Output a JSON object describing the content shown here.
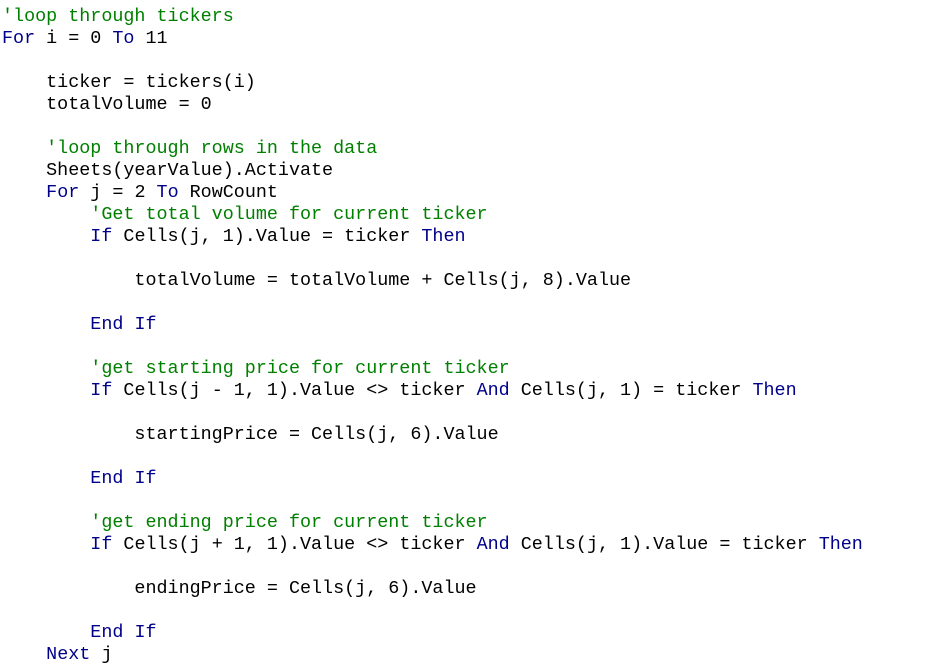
{
  "colors": {
    "background": "#ffffff",
    "plain_text": "#000000",
    "comment": "#008000",
    "keyword": "#00008b"
  },
  "code": {
    "lines": [
      [
        {
          "t": "'loop through tickers",
          "k": "comment"
        }
      ],
      [
        {
          "t": "For",
          "k": "keyword"
        },
        {
          "t": " i = 0 ",
          "k": "plain"
        },
        {
          "t": "To",
          "k": "keyword"
        },
        {
          "t": " 11",
          "k": "plain"
        }
      ],
      [],
      [
        {
          "t": "    ticker = tickers(i)",
          "k": "plain"
        }
      ],
      [
        {
          "t": "    totalVolume = 0",
          "k": "plain"
        }
      ],
      [],
      [
        {
          "t": "    'loop through rows in the data",
          "k": "comment"
        }
      ],
      [
        {
          "t": "    Sheets(yearValue).Activate",
          "k": "plain"
        }
      ],
      [
        {
          "t": "    ",
          "k": "plain"
        },
        {
          "t": "For",
          "k": "keyword"
        },
        {
          "t": " j = 2 ",
          "k": "plain"
        },
        {
          "t": "To",
          "k": "keyword"
        },
        {
          "t": " RowCount",
          "k": "plain"
        }
      ],
      [
        {
          "t": "        'Get total volume for current ticker",
          "k": "comment"
        }
      ],
      [
        {
          "t": "        ",
          "k": "plain"
        },
        {
          "t": "If",
          "k": "keyword"
        },
        {
          "t": " Cells(j, 1).Value = ticker ",
          "k": "plain"
        },
        {
          "t": "Then",
          "k": "keyword"
        }
      ],
      [],
      [
        {
          "t": "            totalVolume = totalVolume + Cells(j, 8).Value",
          "k": "plain"
        }
      ],
      [],
      [
        {
          "t": "        ",
          "k": "plain"
        },
        {
          "t": "End If",
          "k": "keyword"
        }
      ],
      [],
      [
        {
          "t": "        'get starting price for current ticker",
          "k": "comment"
        }
      ],
      [
        {
          "t": "        ",
          "k": "plain"
        },
        {
          "t": "If",
          "k": "keyword"
        },
        {
          "t": " Cells(j - 1, 1).Value <> ticker ",
          "k": "plain"
        },
        {
          "t": "And",
          "k": "keyword"
        },
        {
          "t": " Cells(j, 1) = ticker ",
          "k": "plain"
        },
        {
          "t": "Then",
          "k": "keyword"
        }
      ],
      [],
      [
        {
          "t": "            startingPrice = Cells(j, 6).Value",
          "k": "plain"
        }
      ],
      [],
      [
        {
          "t": "        ",
          "k": "plain"
        },
        {
          "t": "End If",
          "k": "keyword"
        }
      ],
      [],
      [
        {
          "t": "        'get ending price for current ticker",
          "k": "comment"
        }
      ],
      [
        {
          "t": "        ",
          "k": "plain"
        },
        {
          "t": "If",
          "k": "keyword"
        },
        {
          "t": " Cells(j + 1, 1).Value <> ticker ",
          "k": "plain"
        },
        {
          "t": "And",
          "k": "keyword"
        },
        {
          "t": " Cells(j, 1).Value = ticker ",
          "k": "plain"
        },
        {
          "t": "Then",
          "k": "keyword"
        }
      ],
      [],
      [
        {
          "t": "            endingPrice = Cells(j, 6).Value",
          "k": "plain"
        }
      ],
      [],
      [
        {
          "t": "        ",
          "k": "plain"
        },
        {
          "t": "End If",
          "k": "keyword"
        }
      ],
      [
        {
          "t": "    ",
          "k": "plain"
        },
        {
          "t": "Next",
          "k": "keyword"
        },
        {
          "t": " j",
          "k": "plain"
        }
      ]
    ]
  }
}
